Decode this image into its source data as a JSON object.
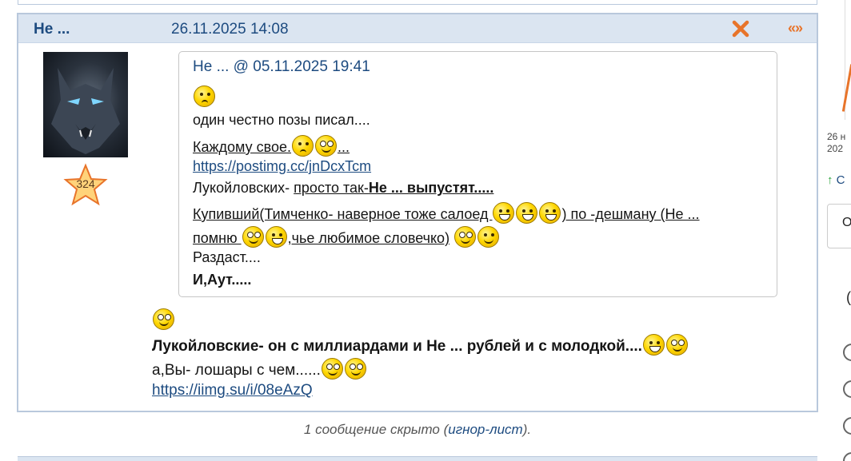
{
  "post": {
    "author": "Не ...",
    "date": "26.11.2025 14:08",
    "reply_icon": "«»",
    "close_icon": "close-icon",
    "rating": "324",
    "quote": {
      "header": "Не ... @ 05.11.2025 19:41",
      "line1": "один честно позы писал....",
      "line2_text": "Каждому свое.",
      "line2_tail": "...",
      "link": "https://postimg.cc/jnDcxTcm",
      "line4_prefix": "Лукойловских- ",
      "line4_underlined": "просто так-",
      "line4_bold": "Не ... выпустят.....",
      "line5_text": "Купивший(Тимченко- наверное тоже салоед ",
      "line5_tail": ") по -дешману (Не ...",
      "line6_text": "помню ",
      "line6_mid": ",чье любимое словечко)",
      "line7": "Раздаст....",
      "line8": "И,Аут....."
    },
    "body": {
      "line1_bold": "Лукойловские- он с миллиардами и Не ... рублей и с молодкой....",
      "line2": "а,Вы- лошары с чем......",
      "link": "https://iimg.su/i/08eAzQ"
    }
  },
  "footer": {
    "prefix": "1 сообщение скрыто (",
    "link": "игнор-лист",
    "suffix": ")."
  },
  "sidebar": {
    "date_fragment_1": "26 н",
    "date_fragment_2": "202",
    "arrow_label": "С",
    "field_value": "О",
    "paren": "("
  },
  "colors": {
    "header_bg": "#dbe5f1",
    "border": "#b9c8dc",
    "link": "#1d4b80",
    "accent": "#e8742a"
  }
}
